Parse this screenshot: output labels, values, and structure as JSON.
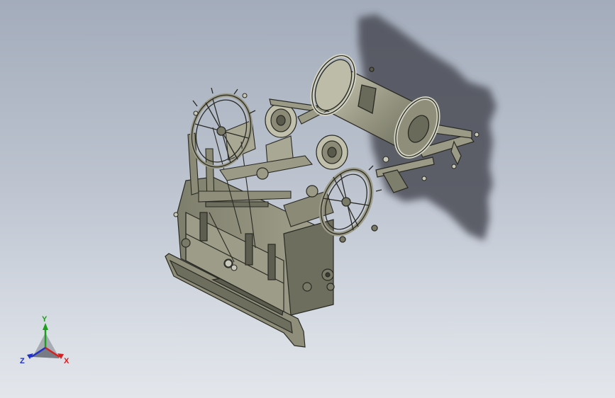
{
  "colors": {
    "background_top": "#a3acbb",
    "background_bottom": "#e3e6eb",
    "model_body": "#8c8c78",
    "model_light": "#c4c4b0",
    "model_dark": "#4e4e42",
    "edge": "#2a2a24",
    "shadow": "#4b4e56",
    "axis_x": "#d42020",
    "axis_y": "#1aa01a",
    "axis_z": "#2030c8"
  },
  "triad": {
    "x_label": "X",
    "y_label": "Y",
    "z_label": "Z"
  }
}
